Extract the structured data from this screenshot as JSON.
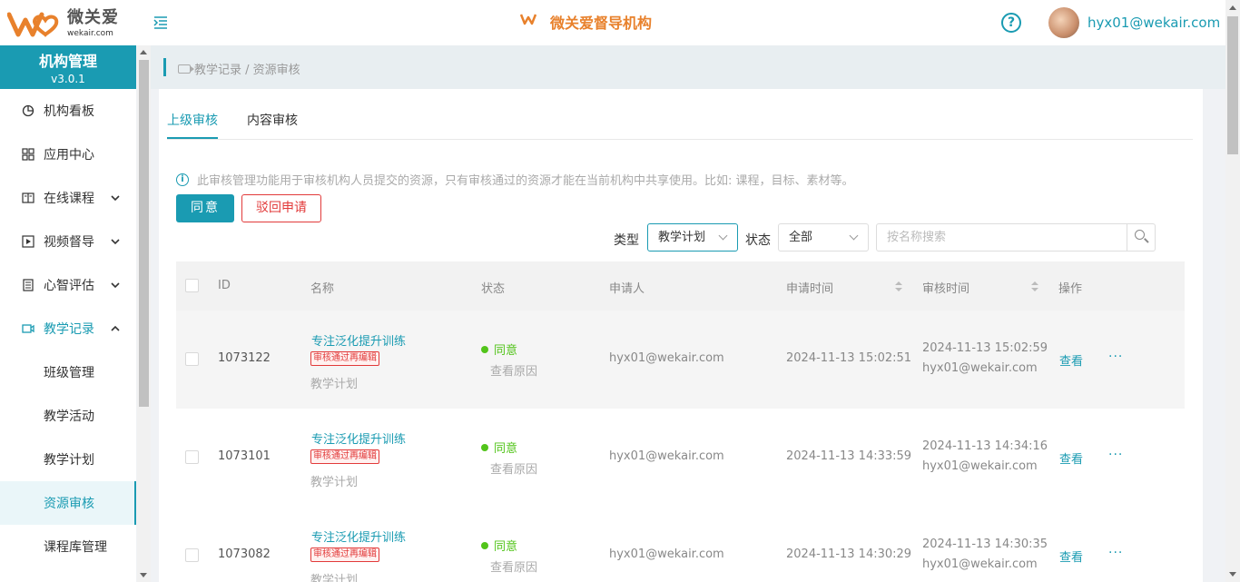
{
  "header": {
    "logo_cn": "微关爱",
    "logo_en": "wekair.com",
    "brand_mini": "微关爱",
    "brand_title": "微关爱督导机构",
    "help_icon": "question-circle-icon",
    "user_email": "hyx01@wekair.com"
  },
  "sidebar": {
    "org_title": "机构管理",
    "version": "v3.0.1",
    "items": [
      {
        "label": "机构看板",
        "icon": "pie-chart-icon"
      },
      {
        "label": "应用中心",
        "icon": "grid-apps-icon"
      },
      {
        "label": "在线课程",
        "icon": "book-icon",
        "chevron": "down"
      },
      {
        "label": "视频督导",
        "icon": "play-square-icon",
        "chevron": "down"
      },
      {
        "label": "心智评估",
        "icon": "list-doc-icon",
        "chevron": "down"
      },
      {
        "label": "教学记录",
        "icon": "video-camera-icon",
        "chevron": "up"
      }
    ],
    "sub_items": [
      {
        "label": "班级管理"
      },
      {
        "label": "教学活动"
      },
      {
        "label": "教学计划"
      },
      {
        "label": "资源审核"
      },
      {
        "label": "课程库管理"
      }
    ]
  },
  "breadcrumb": "教学记录 / 资源审核",
  "tabs": [
    {
      "label": "上级审核",
      "active": true
    },
    {
      "label": "内容审核",
      "active": false
    }
  ],
  "info_text": "此审核管理功能用于审核机构人员提交的资源，只有审核通过的资源才能在当前机构中共享使用。比如: 课程，目标、素材等。",
  "buttons": {
    "agree": "同意",
    "reject": "驳回申请"
  },
  "filters": {
    "type_label": "类型",
    "type_value": "教学计划",
    "status_label": "状态",
    "status_value": "全部",
    "search_placeholder": "按名称搜索"
  },
  "table": {
    "headers": {
      "id": "ID",
      "name": "名称",
      "status": "状态",
      "applicant": "申请人",
      "apply_time": "申请时间",
      "review_time": "审核时间",
      "action": "操作"
    },
    "rows": [
      {
        "id": "1073122",
        "name": "专注泛化提升训练",
        "tag": "审核通过再编辑",
        "type": "教学计划",
        "status": "同意",
        "reason": "查看原因",
        "applicant": "hyx01@wekair.com",
        "apply_time": "2024-11-13 15:02:51",
        "review_time": "2024-11-13 15:02:59",
        "reviewer": "hyx01@wekair.com",
        "view": "查看",
        "more": "···"
      },
      {
        "id": "1073101",
        "name": "专注泛化提升训练",
        "tag": "审核通过再编辑",
        "type": "教学计划",
        "status": "同意",
        "reason": "查看原因",
        "applicant": "hyx01@wekair.com",
        "apply_time": "2024-11-13 14:33:59",
        "review_time": "2024-11-13 14:34:16",
        "reviewer": "hyx01@wekair.com",
        "view": "查看",
        "more": "···"
      },
      {
        "id": "1073082",
        "name": "专注泛化提升训练",
        "tag": "审核通过再编辑",
        "type": "教学计划",
        "status": "同意",
        "reason": "查看原因",
        "applicant": "hyx01@wekair.com",
        "apply_time": "2024-11-13 14:30:29",
        "review_time": "2024-11-13 14:30:35",
        "reviewer": "hyx01@wekair.com",
        "view": "查看",
        "more": "···"
      }
    ]
  },
  "colors": {
    "primary": "#1a9bb2",
    "brand_orange": "#e8812c",
    "danger": "#e23a3a",
    "success": "#52c41a"
  }
}
